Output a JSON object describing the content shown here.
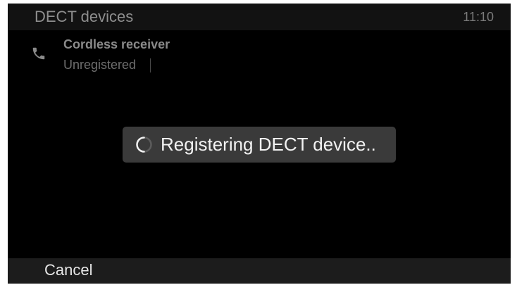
{
  "header": {
    "title": "DECT devices",
    "time": "11:10"
  },
  "device": {
    "icon": "phone-icon",
    "name": "Cordless receiver",
    "status": "Unregistered"
  },
  "toast": {
    "icon": "spinner-icon",
    "message": "Registering DECT device.."
  },
  "footer": {
    "cancel_label": "Cancel"
  }
}
